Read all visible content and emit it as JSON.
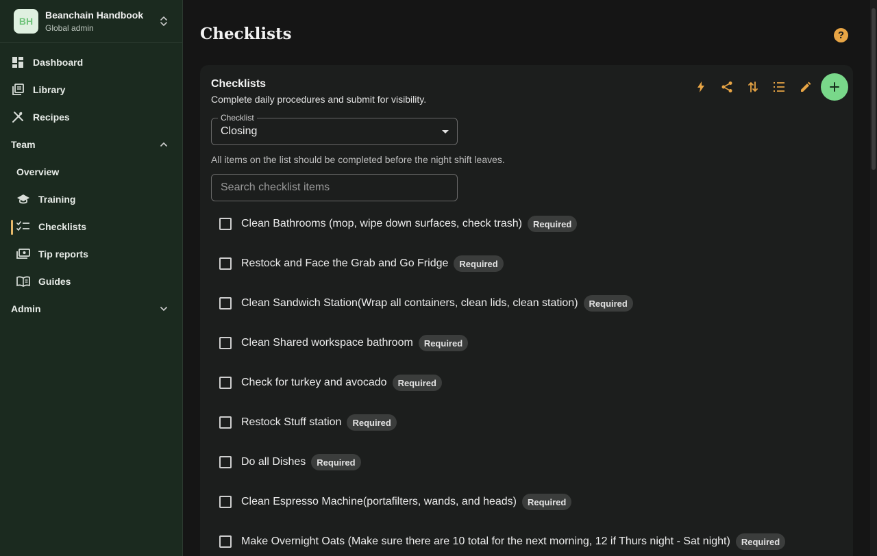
{
  "brand": {
    "initials": "BH",
    "title": "Beanchain Handbook",
    "subtitle": "Global admin"
  },
  "nav": {
    "items": [
      {
        "label": "Dashboard",
        "icon": "dashboard-icon"
      },
      {
        "label": "Library",
        "icon": "library-icon"
      },
      {
        "label": "Recipes",
        "icon": "utensils-icon"
      }
    ],
    "team": {
      "label": "Team",
      "expanded": true,
      "items": [
        {
          "label": "Overview"
        },
        {
          "label": "Training",
          "icon": "school-icon"
        },
        {
          "label": "Checklists",
          "icon": "checklist-icon",
          "active": true
        },
        {
          "label": "Tip reports",
          "icon": "money-icon"
        },
        {
          "label": "Guides",
          "icon": "book-icon"
        }
      ]
    },
    "admin": {
      "label": "Admin",
      "expanded": false
    }
  },
  "page": {
    "title": "Checklists",
    "help_icon": "help-icon"
  },
  "card": {
    "title": "Checklists",
    "subtitle": "Complete daily procedures and submit for visibility.",
    "toolbar": [
      "bolt-icon",
      "share-icon",
      "sort-icon",
      "list-icon",
      "edit-icon",
      "add-icon"
    ],
    "select": {
      "label": "Checklist",
      "value": "Closing"
    },
    "description": "All items on the list should be completed before the night shift leaves.",
    "search_placeholder": "Search checklist items",
    "items": [
      {
        "label": "Clean Bathrooms (mop, wipe down surfaces, check trash)",
        "badge": "Required",
        "checked": false
      },
      {
        "label": "Restock and Face the Grab and Go Fridge",
        "badge": "Required",
        "checked": false
      },
      {
        "label": "Clean Sandwich Station(Wrap all containers, clean lids, clean station)",
        "badge": "Required",
        "checked": false
      },
      {
        "label": "Clean Shared workspace bathroom",
        "badge": "Required",
        "checked": false
      },
      {
        "label": "Check for turkey and avocado",
        "badge": "Required",
        "checked": false
      },
      {
        "label": "Restock Stuff station",
        "badge": "Required",
        "checked": false
      },
      {
        "label": "Do all Dishes",
        "badge": "Required",
        "checked": false
      },
      {
        "label": "Clean Espresso Machine(portafilters, wands, and heads)",
        "badge": "Required",
        "checked": false
      },
      {
        "label": "Make Overnight Oats (Make sure there are 10 total for the next morning, 12 if Thurs night - Sat night)",
        "badge": "Required",
        "checked": false
      }
    ]
  },
  "colors": {
    "accent": "#e8a545",
    "add_button": "#79d88a",
    "sidebar_bg": "#1b2a1f",
    "active_indicator": "#e5b86a"
  }
}
